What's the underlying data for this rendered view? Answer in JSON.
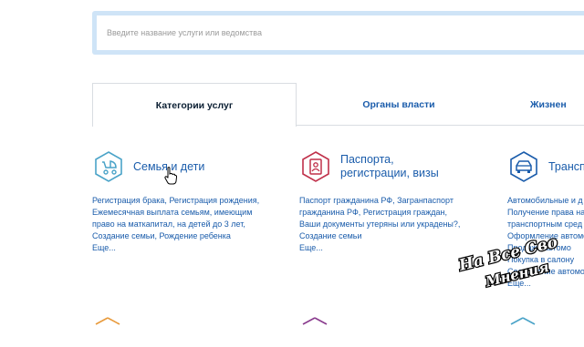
{
  "search": {
    "placeholder": "Введите название услуги или ведомства"
  },
  "tabs": [
    {
      "label": "Категории услуг",
      "active": true
    },
    {
      "label": "Органы власти",
      "active": false
    },
    {
      "label": "Жизнен",
      "active": false
    }
  ],
  "categories": [
    {
      "title_lines": [
        "Семья и дети"
      ],
      "icon": "stroller-icon",
      "icon_color": "#4aa3c8",
      "links": [
        [
          "Регистрация брака",
          ", ",
          "Регистрация рождения",
          ","
        ],
        [
          "Ежемесячная выплата семьям, имеющим"
        ],
        [
          "право на маткапитал, на детей до 3 лет",
          ","
        ],
        [
          "Создание семьи",
          ", ",
          "Рождение ребенка"
        ]
      ],
      "more": "Еще..."
    },
    {
      "title_lines": [
        "Паспорта,",
        "регистрации, визы"
      ],
      "icon": "passport-icon",
      "icon_color": "#c0304a",
      "links": [
        [
          "Паспорт гражданина РФ",
          ", ",
          "Загранпаспорт"
        ],
        [
          "гражданина РФ",
          ", ",
          "Регистрация граждан",
          ","
        ],
        [
          "Ваши документы утеряны или украдены?",
          ","
        ],
        [
          "Создание семьи"
        ]
      ],
      "more": "Еще..."
    },
    {
      "title_lines": [
        "Трансп"
      ],
      "icon": "car-icon",
      "icon_color": "#1a5cab",
      "links": [
        [
          "Автомобильные и д"
        ],
        [
          "Получение права на"
        ],
        [
          "транспортным сред"
        ],
        [
          "Оформление автомо"
        ],
        [
          "Продажа автомо"
        ],
        [
          "Покупка в салону"
        ],
        [
          "Содержание автомо"
        ]
      ],
      "more": "Еще..."
    }
  ],
  "watermark": {
    "line1": "На Все Сво",
    "line2": "Мнения"
  },
  "colors": {
    "link": "#1a5cab",
    "search_frame": "#cfe4f7",
    "tab_border": "#d9dde2"
  }
}
